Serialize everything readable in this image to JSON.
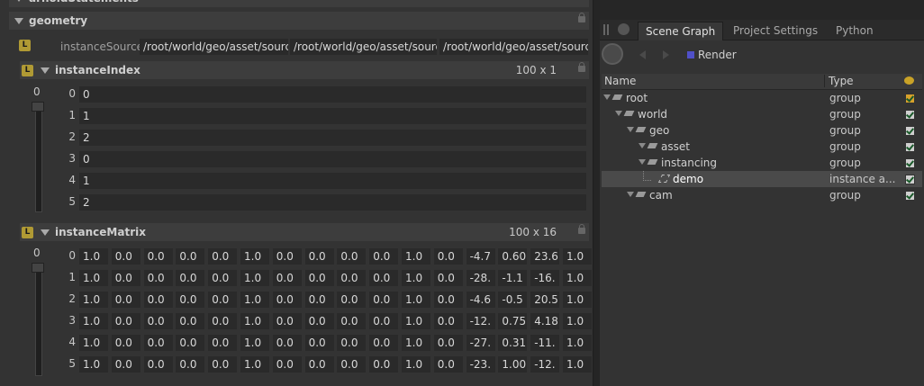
{
  "left": {
    "partial_header": "arnoldStatements",
    "geometry": {
      "title": "geometry",
      "badge": "L",
      "instanceSource_label": "instanceSource",
      "instanceSource_values": [
        "/root/world/geo/asset/source",
        "/root/world/geo/asset/source",
        "/root/world/geo/asset/source"
      ]
    },
    "instanceIndex": {
      "title": "instanceIndex",
      "badge": "L",
      "dims": "100  x 1",
      "slider_value": "0",
      "rows": [
        {
          "index": "0",
          "value": "0"
        },
        {
          "index": "1",
          "value": "1"
        },
        {
          "index": "2",
          "value": "2"
        },
        {
          "index": "3",
          "value": "0"
        },
        {
          "index": "4",
          "value": "1"
        },
        {
          "index": "5",
          "value": "2"
        }
      ]
    },
    "instanceMatrix": {
      "title": "instanceMatrix",
      "badge": "L",
      "dims": "100  x 16",
      "slider_value": "0",
      "rows": [
        {
          "index": "0",
          "values": [
            "1.0",
            "0.0",
            "0.0",
            "0.0",
            "0.0",
            "1.0",
            "0.0",
            "0.0",
            "0.0",
            "0.0",
            "1.0",
            "0.0",
            "-4.7",
            "0.60",
            "23.6",
            "1.0"
          ]
        },
        {
          "index": "1",
          "values": [
            "1.0",
            "0.0",
            "0.0",
            "0.0",
            "0.0",
            "1.0",
            "0.0",
            "0.0",
            "0.0",
            "0.0",
            "1.0",
            "0.0",
            "-28.",
            "-1.1",
            "-16.",
            "1.0"
          ]
        },
        {
          "index": "2",
          "values": [
            "1.0",
            "0.0",
            "0.0",
            "0.0",
            "0.0",
            "1.0",
            "0.0",
            "0.0",
            "0.0",
            "0.0",
            "1.0",
            "0.0",
            "-4.6",
            "-0.5",
            "20.5",
            "1.0"
          ]
        },
        {
          "index": "3",
          "values": [
            "1.0",
            "0.0",
            "0.0",
            "0.0",
            "0.0",
            "1.0",
            "0.0",
            "0.0",
            "0.0",
            "0.0",
            "1.0",
            "0.0",
            "-12.",
            "0.75",
            "4.18",
            "1.0"
          ]
        },
        {
          "index": "4",
          "values": [
            "1.0",
            "0.0",
            "0.0",
            "0.0",
            "0.0",
            "1.0",
            "0.0",
            "0.0",
            "0.0",
            "0.0",
            "1.0",
            "0.0",
            "-27.",
            "0.31",
            "-11.",
            "1.0"
          ]
        },
        {
          "index": "5",
          "values": [
            "1.0",
            "0.0",
            "0.0",
            "0.0",
            "0.0",
            "1.0",
            "0.0",
            "0.0",
            "0.0",
            "0.0",
            "1.0",
            "0.0",
            "-23.",
            "1.00",
            "-12.",
            "1.0"
          ]
        }
      ]
    }
  },
  "right": {
    "tabs": [
      "Scene Graph",
      "Project Settings",
      "Python"
    ],
    "active_tab": "Scene Graph",
    "render_label": "Render",
    "render_color": "#5050c8",
    "columns": {
      "name": "Name",
      "type": "Type"
    },
    "tree": [
      {
        "name": "root",
        "type": "group",
        "depth": 0,
        "checked": true,
        "check_color": "orange"
      },
      {
        "name": "world",
        "type": "group",
        "depth": 1,
        "checked": true
      },
      {
        "name": "geo",
        "type": "group",
        "depth": 2,
        "checked": true
      },
      {
        "name": "asset",
        "type": "group",
        "depth": 3,
        "checked": true
      },
      {
        "name": "instancing",
        "type": "group",
        "depth": 3,
        "checked": true
      },
      {
        "name": "demo",
        "type": "instance a...",
        "depth": 4,
        "checked": true,
        "selected": true
      },
      {
        "name": "cam",
        "type": "group",
        "depth": 2,
        "checked": true
      }
    ]
  }
}
